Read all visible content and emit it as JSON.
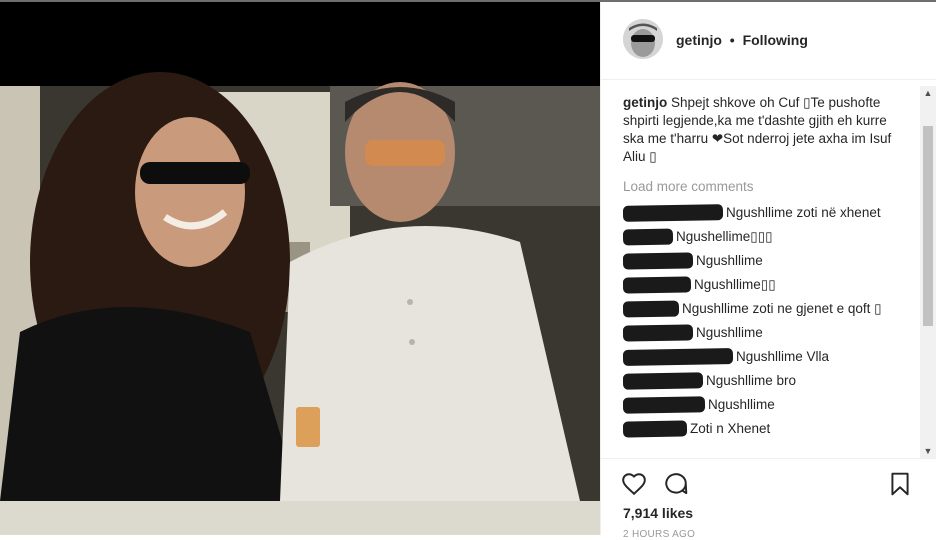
{
  "post": {
    "username": "getinjo",
    "separator": "•",
    "follow_status": "Following"
  },
  "caption": {
    "username": "getinjo",
    "text": "Shpejt shkove oh Cuf ▯Te pushofte shpirti legjende,ka me t'dashte gjith eh kurre ska me t'harru ❤Sot nderroj jete axha im Isuf Aliu ▯"
  },
  "load_more": "Load more comments",
  "comments": [
    {
      "text": "Ngushllime zoti në xhenet"
    },
    {
      "text": "Ngushellime▯▯▯"
    },
    {
      "text": "Ngushllime"
    },
    {
      "text": "Ngushllime▯▯"
    },
    {
      "text": "Ngushllime zoti ne gjenet e qoft ▯"
    },
    {
      "text": "Ngushllime"
    },
    {
      "text": "Ngushllime Vlla"
    },
    {
      "text": "Ngushllime bro"
    },
    {
      "text": "Ngushllime"
    },
    {
      "text": "Zoti n Xhenet"
    }
  ],
  "likes": "7,914 likes",
  "timestamp": "2 HOURS AGO",
  "icons": {
    "like": "heart-icon",
    "comment": "comment-icon",
    "save": "bookmark-icon"
  }
}
